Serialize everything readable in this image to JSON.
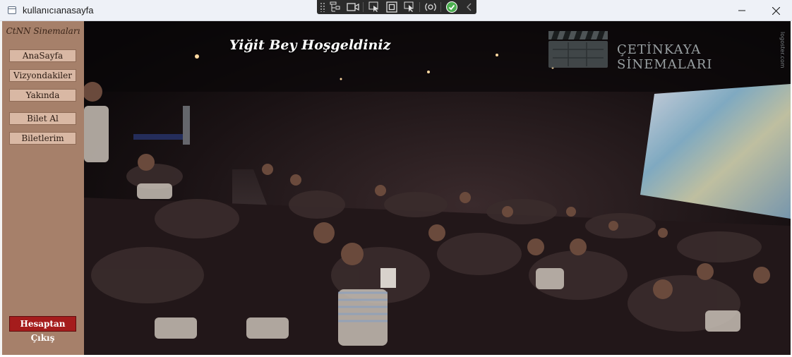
{
  "window": {
    "title": "kullanıcıanasayfa",
    "minimize_icon": "minimize-icon",
    "maximize_icon": "maximize-icon",
    "close_icon": "close-icon"
  },
  "debug_toolbar": {
    "icons": [
      "live-visual-tree-icon",
      "camera-icon",
      "select-element-icon",
      "display-layout-adorners-icon",
      "track-focus-icon",
      "hot-reload-icon",
      "check-icon",
      "collapse-icon"
    ],
    "check_color": "#4caf50"
  },
  "sidebar": {
    "brand": "CtNN Sinemaları",
    "items": [
      {
        "label": "AnaSayfa"
      },
      {
        "label": "Vizyondakiler"
      },
      {
        "label": "Yakında"
      },
      {
        "label": "Bilet Al"
      },
      {
        "label": "Biletlerim"
      }
    ],
    "logout_label": "Hesaptan Çıkış",
    "background_color": "#a6806a",
    "button_color": "#d9b8a4",
    "logout_color": "#a51c1c"
  },
  "main": {
    "welcome_text": "Yiğit Bey Hoşgeldiniz",
    "logo_text": "ÇETİNKAYA SİNEMALARI",
    "logo_small_text": "logoster.com",
    "logo_icon": "clapperboard-icon",
    "background_image": "cinema-audience-photo"
  }
}
